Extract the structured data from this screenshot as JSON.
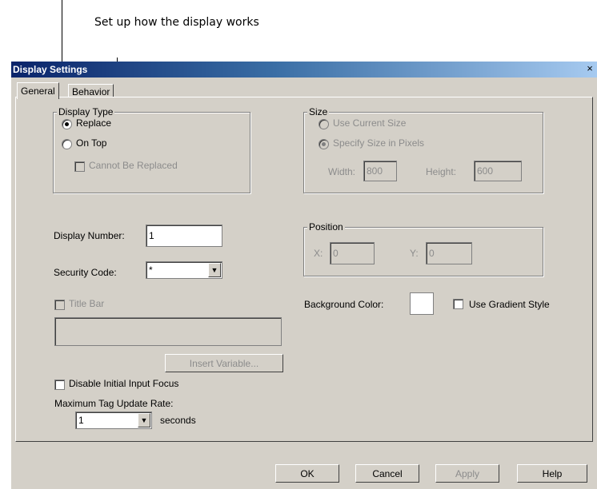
{
  "annotation": {
    "text": "Set up how the display works"
  },
  "dialog": {
    "title": "Display Settings",
    "close_glyph": "×",
    "tabs": [
      {
        "label": "General",
        "active": true
      },
      {
        "label": "Behavior",
        "active": false
      }
    ],
    "display_type": {
      "label": "Display Type",
      "replace_label": "Replace",
      "on_top_label": "On Top",
      "cannot_be_replaced_label": "Cannot Be Replaced",
      "selected": "Replace"
    },
    "size": {
      "label": "Size",
      "use_current_label": "Use Current Size",
      "specify_pixels_label": "Specify Size in Pixels",
      "width_label": "Width:",
      "width_value": "800",
      "height_label": "Height:",
      "height_value": "600"
    },
    "display_number": {
      "label": "Display Number:",
      "value": "1"
    },
    "security_code": {
      "label": "Security Code:",
      "value": "*"
    },
    "position": {
      "label": "Position",
      "x_label": "X:",
      "x_value": "0",
      "y_label": "Y:",
      "y_value": "0"
    },
    "background_color": {
      "label": "Background Color:",
      "color": "#ffffff"
    },
    "use_gradient_label": "Use Gradient Style",
    "title_bar_label": "Title Bar",
    "title_bar_value": "",
    "insert_variable_label": "Insert Variable...",
    "disable_focus_label": "Disable Initial Input Focus",
    "max_tag": {
      "label": "Maximum Tag Update Rate:",
      "value": "1",
      "unit": "seconds"
    },
    "buttons": {
      "ok": "OK",
      "cancel": "Cancel",
      "apply": "Apply",
      "help": "Help"
    }
  }
}
